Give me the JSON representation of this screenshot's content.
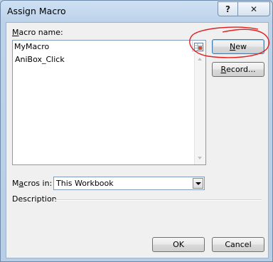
{
  "window": {
    "title": "Assign Macro",
    "help_label": "?",
    "close_label": "✕"
  },
  "macro_name": {
    "label_accel": "M",
    "label_rest": "acro name:",
    "value": "MyMacro"
  },
  "macro_list": {
    "items": [
      "AniBox_Click"
    ]
  },
  "buttons": {
    "new_accel": "N",
    "new_rest": "ew",
    "record_accel": "R",
    "record_rest": "ecord...",
    "ok": "OK",
    "cancel": "Cancel"
  },
  "macros_in": {
    "label_accel": "a",
    "label_pre": "M",
    "label_rest": "cros in:",
    "selected": "This Workbook"
  },
  "description": {
    "label": "Description"
  },
  "colors": {
    "annotation": "#e02020",
    "default_border": "#3c7fb1"
  },
  "icons": [
    "help-icon",
    "close-icon",
    "range-selector-icon",
    "scroll-up-icon",
    "scroll-down-icon",
    "dropdown-arrow-icon"
  ]
}
